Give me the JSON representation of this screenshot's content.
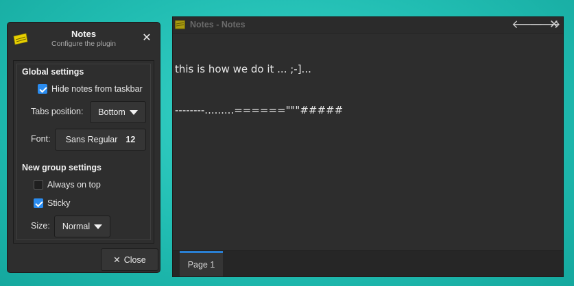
{
  "dialog": {
    "title": "Notes",
    "subtitle": "Configure the plugin",
    "close_glyph": "✕",
    "global_settings": {
      "title": "Global settings",
      "hide_from_taskbar": {
        "label": "Hide notes from taskbar",
        "checked": true
      },
      "tabs_position": {
        "label": "Tabs position:",
        "value": "Bottom"
      },
      "font": {
        "label": "Font:",
        "family": "Sans Regular",
        "size": "12"
      }
    },
    "new_group_settings": {
      "title": "New group settings",
      "always_on_top": {
        "label": "Always on top",
        "checked": false
      },
      "sticky": {
        "label": "Sticky",
        "checked": true
      },
      "size": {
        "label": "Size:",
        "value": "Normal"
      }
    },
    "close_button": {
      "icon": "✕",
      "label": "Close"
    }
  },
  "notes_window": {
    "title": "Notes - Notes",
    "buttons": {
      "back": "🡐",
      "forward": "🡒",
      "close": "✕"
    },
    "content_lines": [
      "this is how we do it ... ;-]...",
      "--------.........======\"\"\"#####"
    ],
    "tabs": [
      {
        "label": "Page 1",
        "active": true
      }
    ]
  },
  "colors": {
    "desktop": "#21bdb2",
    "panel": "#2e2e2e",
    "accent": "#2a8cf0",
    "note_icon": "#e8d000"
  }
}
